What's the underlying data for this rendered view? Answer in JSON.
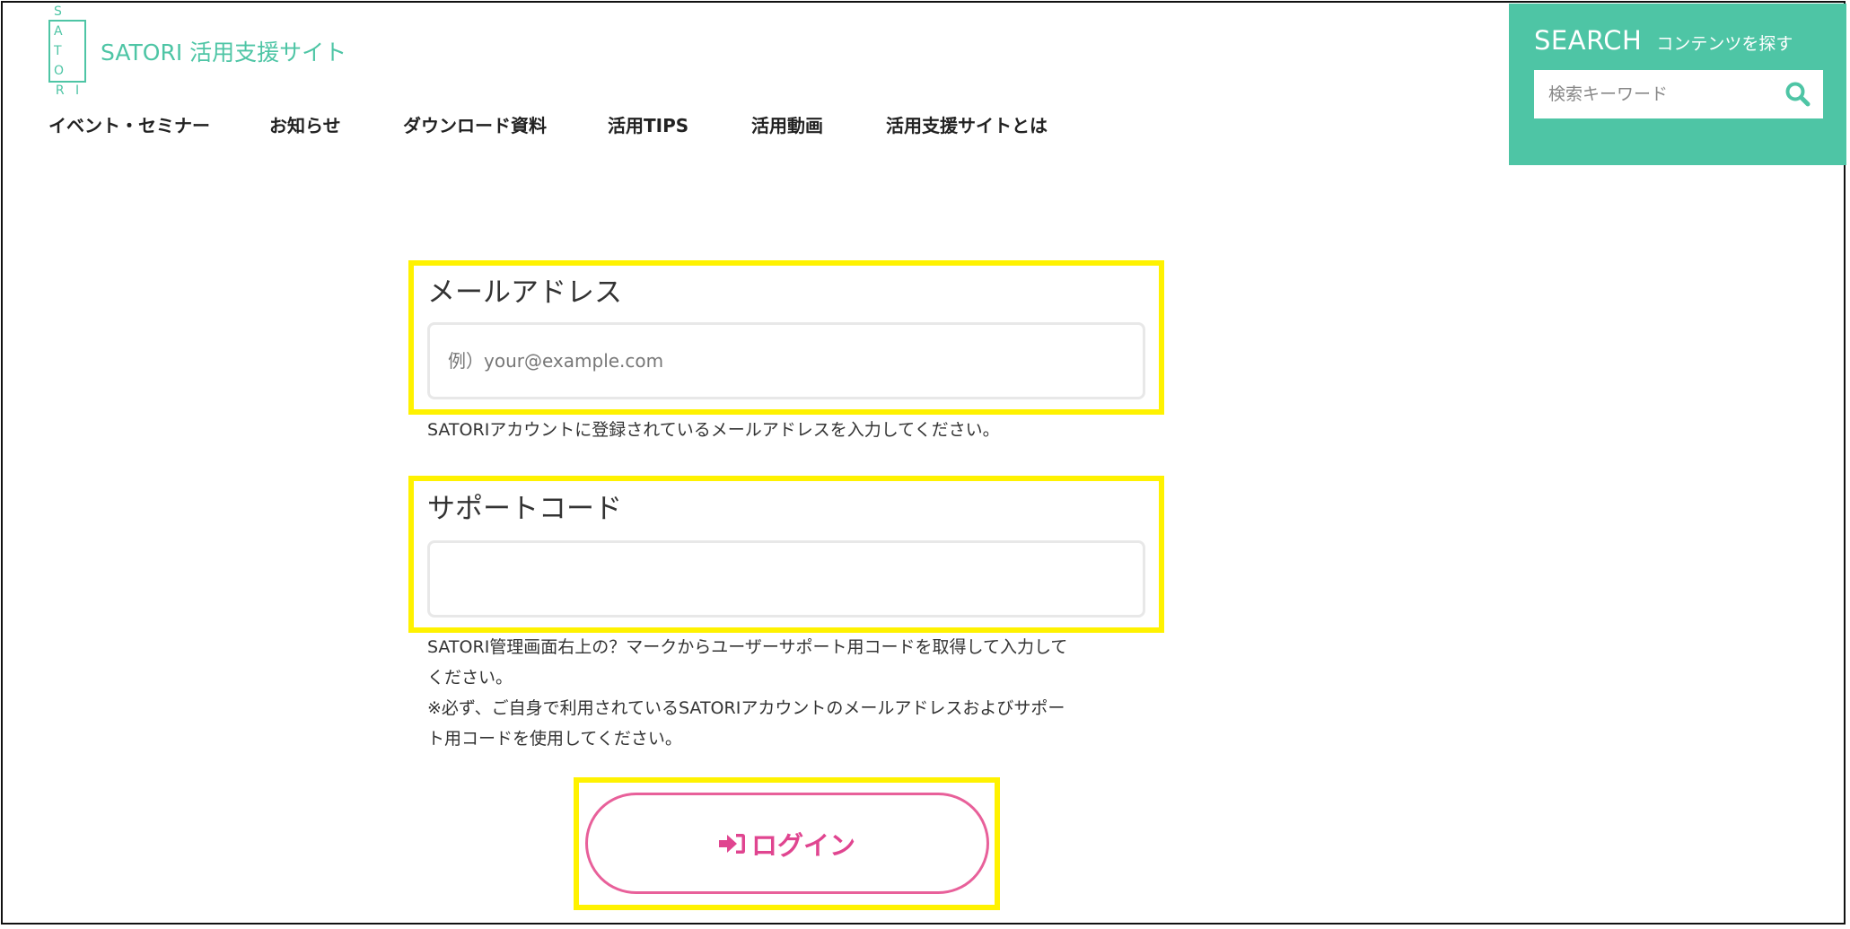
{
  "header": {
    "logo_letters": [
      "S A",
      "T O",
      "R I"
    ],
    "site_title": "SATORI 活用支援サイト"
  },
  "nav": {
    "items": [
      {
        "label": "イベント・セミナー"
      },
      {
        "label": "お知らせ"
      },
      {
        "label": "ダウンロード資料"
      },
      {
        "label": "活用TIPS"
      },
      {
        "label": "活用動画"
      },
      {
        "label": "活用支援サイトとは"
      }
    ]
  },
  "search": {
    "title": "SEARCH",
    "subtitle": "コンテンツを探す",
    "placeholder": "検索キーワード",
    "icon": "search-icon"
  },
  "form": {
    "email": {
      "label": "メールアドレス",
      "placeholder": "例）your@example.com",
      "value": "",
      "help": "SATORIアカウントに登録されているメールアドレスを入力してください。"
    },
    "support_code": {
      "label": "サポートコード",
      "placeholder": "",
      "value": "",
      "help_lines": [
        "SATORI管理画面右上の？マークからユーザーサポート用コードを取得して入力して",
        "ください。",
        "※必ず、ご自身で利用されているSATORIアカウントのメールアドレスおよびサポー",
        "ト用コードを使用してください。"
      ]
    },
    "login": {
      "label": "ログイン",
      "icon": "sign-in-icon"
    }
  },
  "colors": {
    "brand": "#4ec5a5",
    "highlight": "#fff200",
    "login": "#e04590"
  }
}
